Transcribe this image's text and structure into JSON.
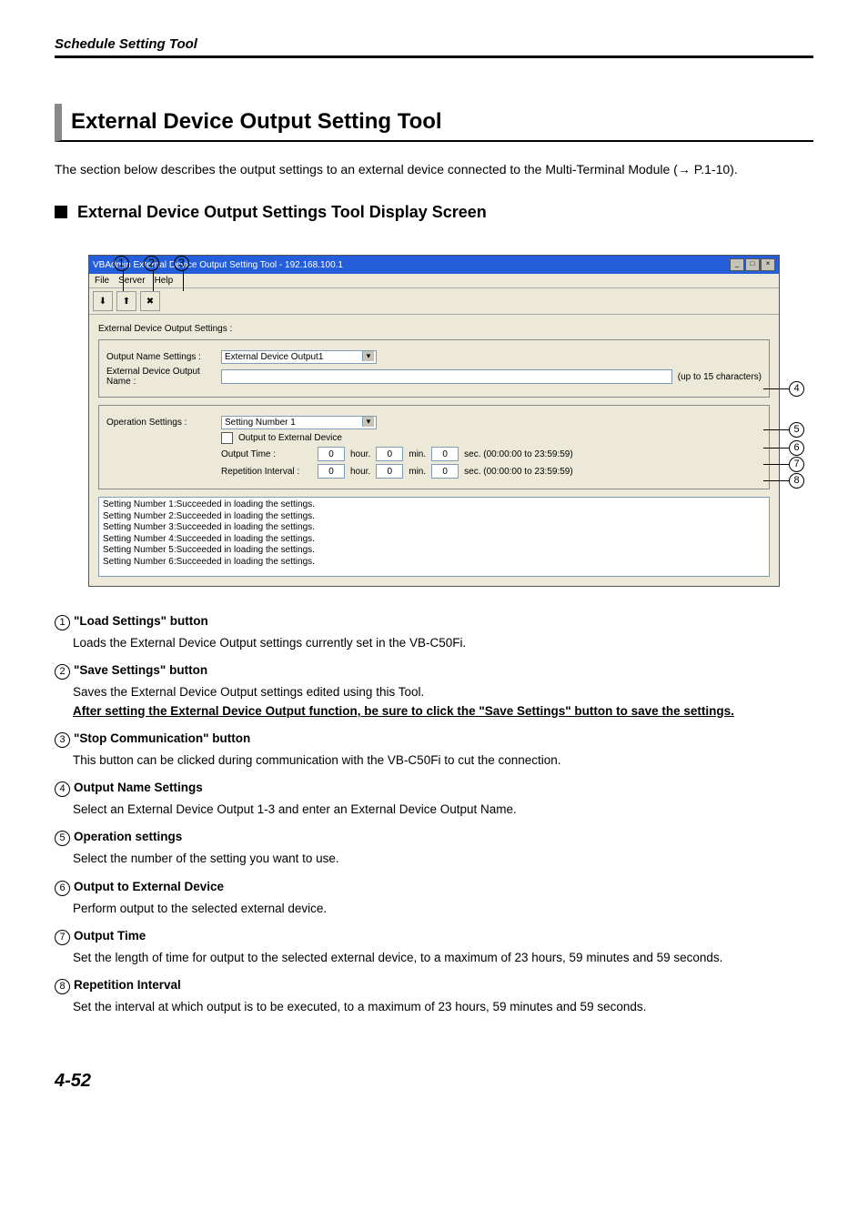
{
  "header": {
    "chapter": "Schedule Setting Tool"
  },
  "section": {
    "title": "External Device Output Setting Tool"
  },
  "intro": "The section below describes the output settings to an external device connected to the Multi-Terminal Module (→ P.1-10).",
  "subsection": {
    "title": "External Device Output Settings Tool Display Screen"
  },
  "screenshot": {
    "window_title": "VBAdmin External Device Output Setting Tool - 192.168.100.1",
    "menu": {
      "file": "File",
      "server": "Server",
      "help": "Help"
    },
    "group_label": "External Device Output Settings :",
    "output_name_label": "Output Name Settings :",
    "output_name_value": "External Device Output1",
    "output_name_field_label": "External Device Output Name :",
    "output_name_hint": "(up to 15 characters)",
    "operation_label": "Operation Settings :",
    "operation_value": "Setting Number 1",
    "output_to_device": "Output to External Device",
    "output_time_label": "Output Time :",
    "repetition_label": "Repetition Interval :",
    "hour": "hour.",
    "min": "min.",
    "sec_range": "sec. (00:00:00 to 23:59:59)",
    "spin_zero": "0",
    "log": [
      "Setting Number 1:Succeeded in loading the settings.",
      "Setting Number 2:Succeeded in loading the settings.",
      "Setting Number 3:Succeeded in loading the settings.",
      "Setting Number 4:Succeeded in loading the settings.",
      "Setting Number 5:Succeeded in loading the settings.",
      "Setting Number 6:Succeeded in loading the settings."
    ]
  },
  "defs": [
    {
      "num": "1",
      "title": "\"Load Settings\" button",
      "body": "Loads the External Device Output settings currently set in the VB-C50Fi."
    },
    {
      "num": "2",
      "title": "\"Save Settings\" button",
      "body": "Saves the External Device Output settings edited using this Tool.",
      "emphasis": "After setting the External Device Output function, be sure to click the \"Save Settings\" button to save the settings."
    },
    {
      "num": "3",
      "title": "\"Stop Communication\" button",
      "body": "This button can be clicked during communication with the VB-C50Fi to cut the connection."
    },
    {
      "num": "4",
      "title": "Output Name Settings",
      "body": "Select an External Device Output 1-3 and enter an External Device Output Name."
    },
    {
      "num": "5",
      "title": "Operation settings",
      "body": "Select the number of the setting you want to use."
    },
    {
      "num": "6",
      "title": "Output to External Device",
      "body": "Perform output to the selected external device."
    },
    {
      "num": "7",
      "title": "Output Time",
      "body": "Set the length of time for output to the selected external device, to a maximum of 23 hours, 59 minutes and 59 seconds."
    },
    {
      "num": "8",
      "title": "Repetition Interval",
      "body": "Set the interval at which output is to be executed, to a maximum of 23 hours, 59 minutes and 59 seconds."
    }
  ],
  "page_number": "4-52"
}
